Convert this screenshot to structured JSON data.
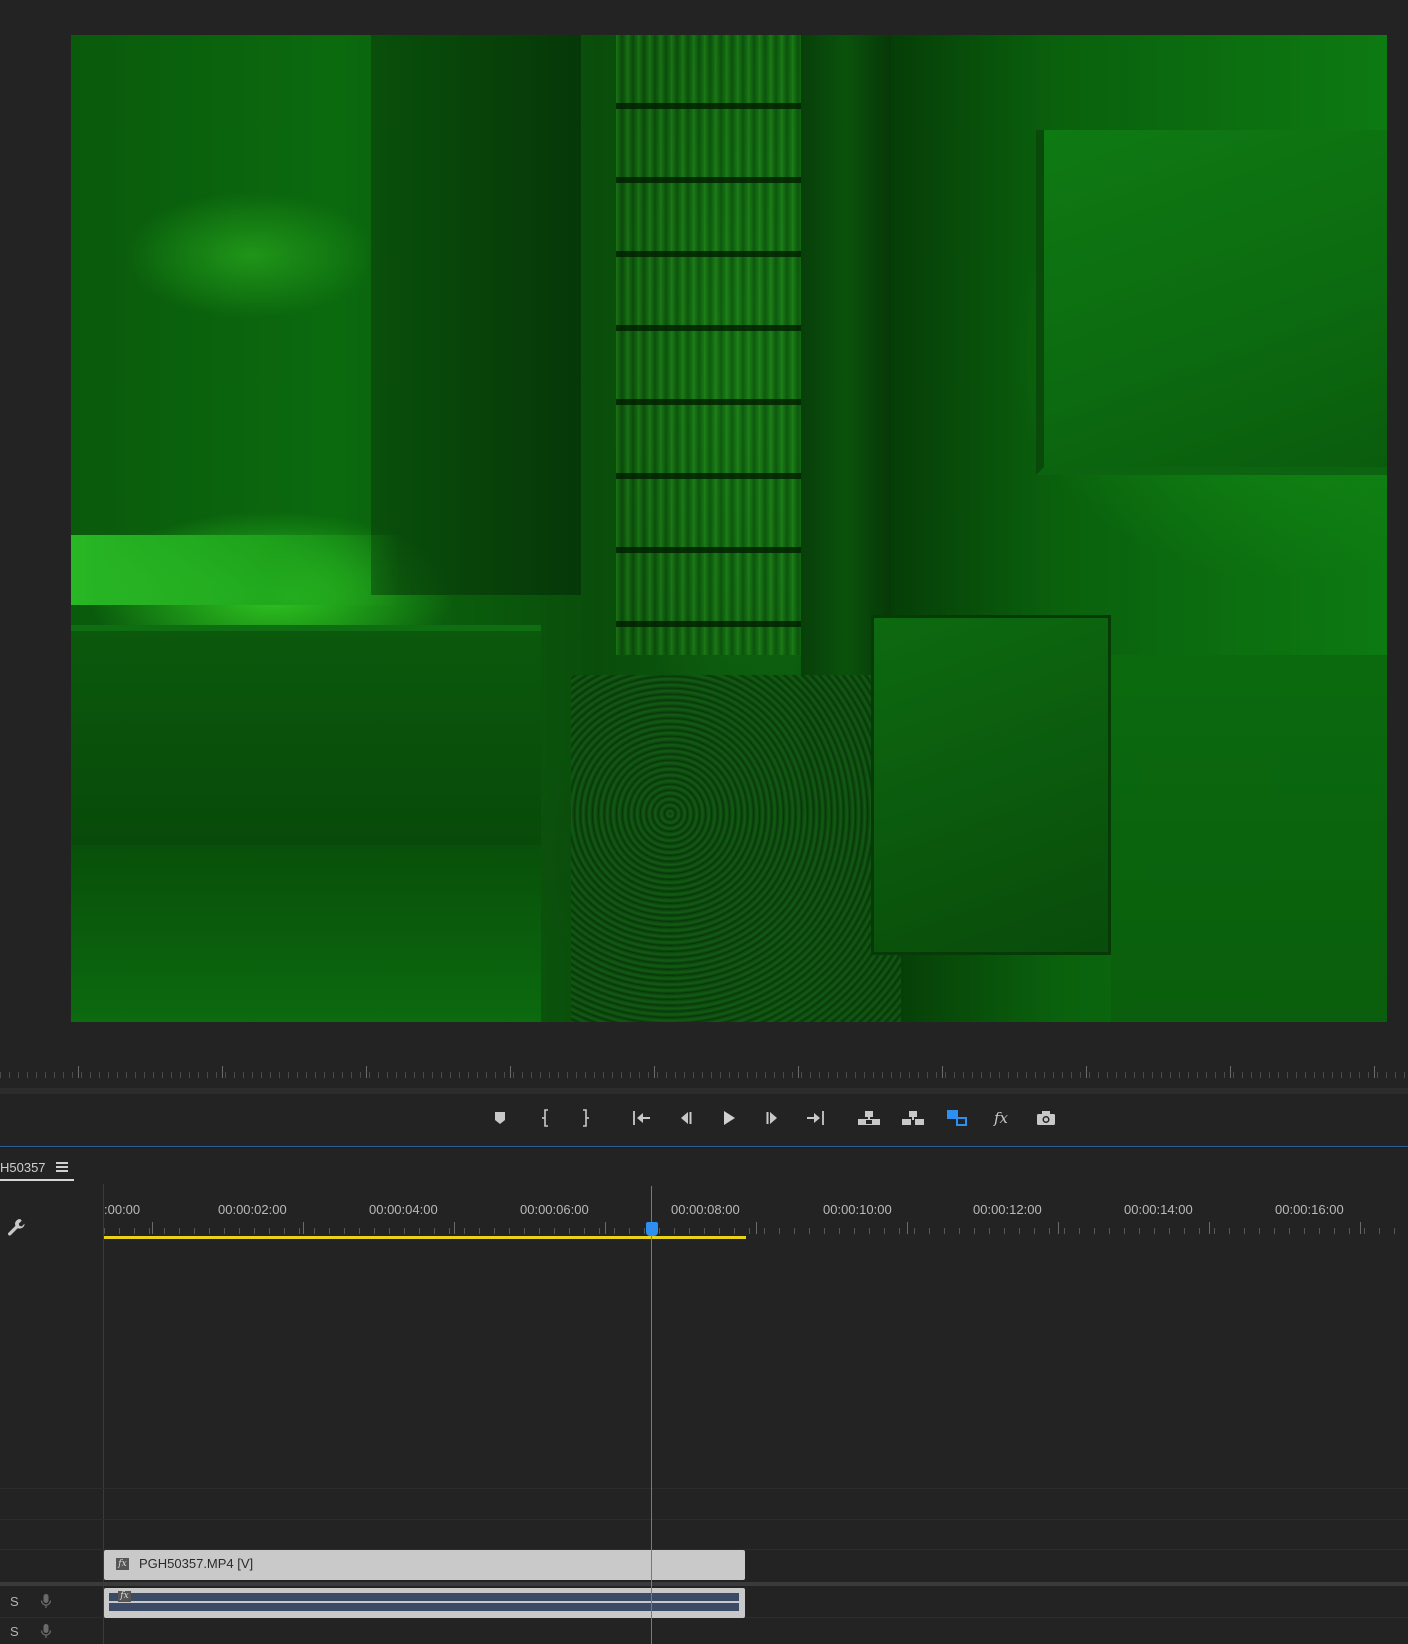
{
  "program_monitor": {
    "frame_description_color": "#0b6a0e"
  },
  "transport": {
    "buttons": [
      {
        "name": "add-marker",
        "label": "Add Marker"
      },
      {
        "name": "mark-in",
        "label": "Mark In"
      },
      {
        "name": "mark-out",
        "label": "Mark Out"
      },
      {
        "name": "go-to-in",
        "label": "Go to In"
      },
      {
        "name": "step-back",
        "label": "Step Back 1 Frame"
      },
      {
        "name": "play",
        "label": "Play-Stop Toggle"
      },
      {
        "name": "step-forward",
        "label": "Step Forward 1 Frame"
      },
      {
        "name": "go-to-out",
        "label": "Go to Out"
      },
      {
        "name": "lift",
        "label": "Lift"
      },
      {
        "name": "extract",
        "label": "Extract"
      },
      {
        "name": "comparison-view",
        "label": "Comparison View"
      },
      {
        "name": "fx-toggle",
        "label": "fx"
      },
      {
        "name": "export-frame",
        "label": "Export Frame"
      }
    ],
    "accent_color": "#2f8ff0"
  },
  "timeline": {
    "tab_label": "H50357",
    "timecodes": [
      ":00:00",
      "00:00:02:00",
      "00:00:04:00",
      "00:00:06:00",
      "00:00:08:00",
      "00:00:10:00",
      "00:00:12:00",
      "00:00:14:00",
      "00:00:16:00"
    ],
    "work_area_color": "#e8d21a",
    "playhead_color": "#2f8ff0",
    "video_clip": {
      "name": "PGH50357.MP4 [V]",
      "fx": "fx"
    },
    "audio_clip": {
      "fx": "fx"
    },
    "audio_tracks": [
      {
        "solo": "S"
      },
      {
        "solo": "S"
      }
    ]
  }
}
